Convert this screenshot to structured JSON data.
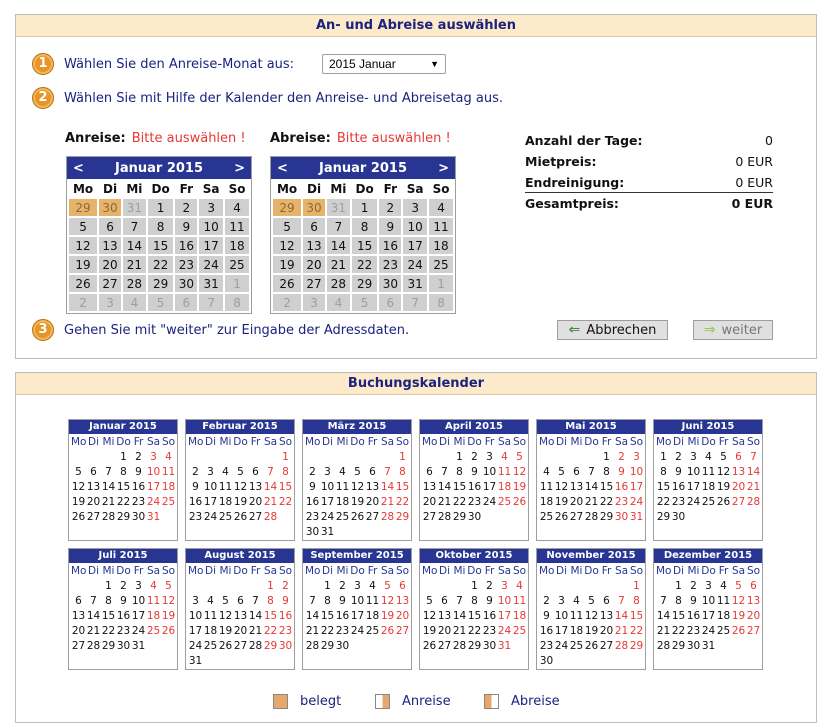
{
  "selection": {
    "title": "An- und Abreise auswählen",
    "step1": {
      "num": "1",
      "text": "Wählen Sie den Anreise-Monat aus:"
    },
    "month_select": {
      "value": "2015 Januar"
    },
    "step2": {
      "num": "2",
      "text": "Wählen Sie mit Hilfe der Kalender den Anreise- und Abreisetag aus."
    },
    "arrival": {
      "label": "Anreise:",
      "value": "Bitte auswählen !"
    },
    "departure": {
      "label": "Abreise:",
      "value": "Bitte auswählen !"
    },
    "step3": {
      "num": "3",
      "text": "Gehen Sie mit \"weiter\" zur Eingabe der Adressdaten."
    },
    "cancel_label": "Abbrechen",
    "next_label": "weiter"
  },
  "bigcal": {
    "month": "Januar 2015",
    "prev": "<",
    "next": ">",
    "weekdays": [
      "Mo",
      "Di",
      "Mi",
      "Do",
      "Fr",
      "Sa",
      "So"
    ],
    "days": [
      [
        "29",
        "30",
        "31",
        "1",
        "2",
        "3",
        "4"
      ],
      [
        "5",
        "6",
        "7",
        "8",
        "9",
        "10",
        "11"
      ],
      [
        "12",
        "13",
        "14",
        "15",
        "16",
        "17",
        "18"
      ],
      [
        "19",
        "20",
        "21",
        "22",
        "23",
        "24",
        "25"
      ],
      [
        "26",
        "27",
        "28",
        "29",
        "30",
        "31",
        "1"
      ],
      [
        "2",
        "3",
        "4",
        "5",
        "6",
        "7",
        "8"
      ]
    ]
  },
  "summary": {
    "days_label": "Anzahl der Tage:",
    "days_value": "0",
    "rent_label": "Mietpreis:",
    "rent_value": "0 EUR",
    "cleaning_label": "Endreinigung:",
    "cleaning_value": "0 EUR",
    "total_label": "Gesamtpreis:",
    "total_value": "0 EUR"
  },
  "booking": {
    "title": "Buchungskalender",
    "weekdays": [
      "Mo",
      "Di",
      "Mi",
      "Do",
      "Fr",
      "Sa",
      "So"
    ],
    "months": [
      {
        "name": "Januar 2015",
        "offset": 3,
        "days": 31
      },
      {
        "name": "Februar 2015",
        "offset": 6,
        "days": 28
      },
      {
        "name": "März 2015",
        "offset": 6,
        "days": 31
      },
      {
        "name": "April 2015",
        "offset": 2,
        "days": 30
      },
      {
        "name": "Mai 2015",
        "offset": 4,
        "days": 31
      },
      {
        "name": "Juni 2015",
        "offset": 0,
        "days": 30
      },
      {
        "name": "Juli 2015",
        "offset": 2,
        "days": 31
      },
      {
        "name": "August 2015",
        "offset": 5,
        "days": 31
      },
      {
        "name": "September 2015",
        "offset": 1,
        "days": 30
      },
      {
        "name": "Oktober 2015",
        "offset": 3,
        "days": 31
      },
      {
        "name": "November 2015",
        "offset": 6,
        "days": 30
      },
      {
        "name": "Dezember 2015",
        "offset": 1,
        "days": 31
      }
    ]
  },
  "legend": {
    "booked": "belegt",
    "arrival": "Anreise",
    "departure": "Abreise"
  },
  "colors": {
    "header_bg": "#fdeacb",
    "calendar_header": "#283593",
    "booked": "#e7a96b",
    "weekend": "#e53935",
    "step_badge": "#e69527"
  }
}
